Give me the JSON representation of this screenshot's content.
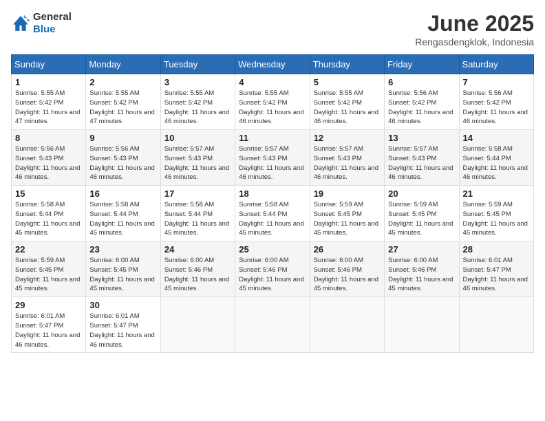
{
  "header": {
    "logo": {
      "general": "General",
      "blue": "Blue"
    },
    "title": "June 2025",
    "subtitle": "Rengasdengklok, Indonesia"
  },
  "weekdays": [
    "Sunday",
    "Monday",
    "Tuesday",
    "Wednesday",
    "Thursday",
    "Friday",
    "Saturday"
  ],
  "weeks": [
    [
      {
        "day": 1,
        "sunrise": "5:55 AM",
        "sunset": "5:42 PM",
        "daylight": "11 hours and 47 minutes."
      },
      {
        "day": 2,
        "sunrise": "5:55 AM",
        "sunset": "5:42 PM",
        "daylight": "11 hours and 47 minutes."
      },
      {
        "day": 3,
        "sunrise": "5:55 AM",
        "sunset": "5:42 PM",
        "daylight": "11 hours and 46 minutes."
      },
      {
        "day": 4,
        "sunrise": "5:55 AM",
        "sunset": "5:42 PM",
        "daylight": "11 hours and 46 minutes."
      },
      {
        "day": 5,
        "sunrise": "5:55 AM",
        "sunset": "5:42 PM",
        "daylight": "11 hours and 46 minutes."
      },
      {
        "day": 6,
        "sunrise": "5:56 AM",
        "sunset": "5:42 PM",
        "daylight": "11 hours and 46 minutes."
      },
      {
        "day": 7,
        "sunrise": "5:56 AM",
        "sunset": "5:42 PM",
        "daylight": "11 hours and 46 minutes."
      }
    ],
    [
      {
        "day": 8,
        "sunrise": "5:56 AM",
        "sunset": "5:43 PM",
        "daylight": "11 hours and 46 minutes."
      },
      {
        "day": 9,
        "sunrise": "5:56 AM",
        "sunset": "5:43 PM",
        "daylight": "11 hours and 46 minutes."
      },
      {
        "day": 10,
        "sunrise": "5:57 AM",
        "sunset": "5:43 PM",
        "daylight": "11 hours and 46 minutes."
      },
      {
        "day": 11,
        "sunrise": "5:57 AM",
        "sunset": "5:43 PM",
        "daylight": "11 hours and 46 minutes."
      },
      {
        "day": 12,
        "sunrise": "5:57 AM",
        "sunset": "5:43 PM",
        "daylight": "11 hours and 46 minutes."
      },
      {
        "day": 13,
        "sunrise": "5:57 AM",
        "sunset": "5:43 PM",
        "daylight": "11 hours and 46 minutes."
      },
      {
        "day": 14,
        "sunrise": "5:58 AM",
        "sunset": "5:44 PM",
        "daylight": "11 hours and 46 minutes."
      }
    ],
    [
      {
        "day": 15,
        "sunrise": "5:58 AM",
        "sunset": "5:44 PM",
        "daylight": "11 hours and 45 minutes."
      },
      {
        "day": 16,
        "sunrise": "5:58 AM",
        "sunset": "5:44 PM",
        "daylight": "11 hours and 45 minutes."
      },
      {
        "day": 17,
        "sunrise": "5:58 AM",
        "sunset": "5:44 PM",
        "daylight": "11 hours and 45 minutes."
      },
      {
        "day": 18,
        "sunrise": "5:58 AM",
        "sunset": "5:44 PM",
        "daylight": "11 hours and 45 minutes."
      },
      {
        "day": 19,
        "sunrise": "5:59 AM",
        "sunset": "5:45 PM",
        "daylight": "11 hours and 45 minutes."
      },
      {
        "day": 20,
        "sunrise": "5:59 AM",
        "sunset": "5:45 PM",
        "daylight": "11 hours and 45 minutes."
      },
      {
        "day": 21,
        "sunrise": "5:59 AM",
        "sunset": "5:45 PM",
        "daylight": "11 hours and 45 minutes."
      }
    ],
    [
      {
        "day": 22,
        "sunrise": "5:59 AM",
        "sunset": "5:45 PM",
        "daylight": "11 hours and 45 minutes."
      },
      {
        "day": 23,
        "sunrise": "6:00 AM",
        "sunset": "5:45 PM",
        "daylight": "11 hours and 45 minutes."
      },
      {
        "day": 24,
        "sunrise": "6:00 AM",
        "sunset": "5:46 PM",
        "daylight": "11 hours and 45 minutes."
      },
      {
        "day": 25,
        "sunrise": "6:00 AM",
        "sunset": "5:46 PM",
        "daylight": "11 hours and 45 minutes."
      },
      {
        "day": 26,
        "sunrise": "6:00 AM",
        "sunset": "5:46 PM",
        "daylight": "11 hours and 45 minutes."
      },
      {
        "day": 27,
        "sunrise": "6:00 AM",
        "sunset": "5:46 PM",
        "daylight": "11 hours and 45 minutes."
      },
      {
        "day": 28,
        "sunrise": "6:01 AM",
        "sunset": "5:47 PM",
        "daylight": "11 hours and 46 minutes."
      }
    ],
    [
      {
        "day": 29,
        "sunrise": "6:01 AM",
        "sunset": "5:47 PM",
        "daylight": "11 hours and 46 minutes."
      },
      {
        "day": 30,
        "sunrise": "6:01 AM",
        "sunset": "5:47 PM",
        "daylight": "11 hours and 46 minutes."
      },
      null,
      null,
      null,
      null,
      null
    ]
  ]
}
